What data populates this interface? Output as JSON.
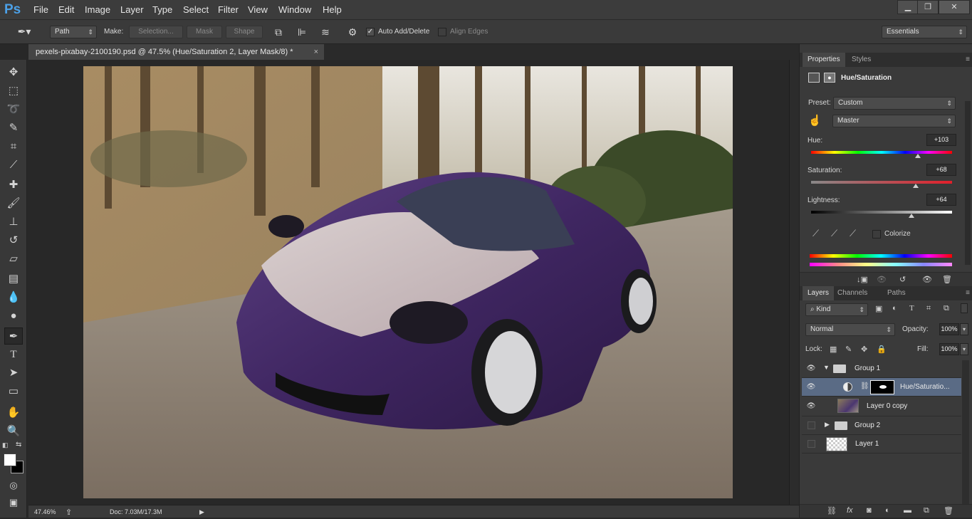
{
  "app": {
    "logo": "Ps"
  },
  "menu": [
    "File",
    "Edit",
    "Image",
    "Layer",
    "Type",
    "Select",
    "Filter",
    "View",
    "Window",
    "Help"
  ],
  "window_controls": {
    "minimize": "▁",
    "restore": "❐",
    "close": "✕"
  },
  "options": {
    "mode": "Path",
    "make_label": "Make:",
    "selection_btn": "Selection...",
    "mask_btn": "Mask",
    "shape_btn": "Shape",
    "auto_add_delete": "Auto Add/Delete",
    "align_edges": "Align Edges",
    "workspace": "Essentials"
  },
  "document": {
    "tab_title": "pexels-pixabay-2100190.psd @ 47.5% (Hue/Saturation 2, Layer Mask/8) *",
    "close": "×"
  },
  "status": {
    "zoom": "47.46%",
    "doc_info": "Doc: 7.03M/17.3M"
  },
  "properties": {
    "tabs": [
      "Properties",
      "Styles"
    ],
    "title": "Hue/Saturation",
    "preset_label": "Preset:",
    "preset_value": "Custom",
    "channel_value": "Master",
    "hue_label": "Hue:",
    "hue_value": "+103",
    "saturation_label": "Saturation:",
    "saturation_value": "+68",
    "lightness_label": "Lightness:",
    "lightness_value": "+64",
    "colorize_label": "Colorize",
    "hue_pos": 0.76,
    "saturation_pos": 0.74,
    "lightness_pos": 0.71
  },
  "layers_panel": {
    "tabs": [
      "Layers",
      "Channels",
      "Paths"
    ],
    "kind_label": "Kind",
    "blend_mode": "Normal",
    "opacity_label": "Opacity:",
    "opacity_value": "100%",
    "lock_label": "Lock:",
    "fill_label": "Fill:",
    "fill_value": "100%",
    "layers": [
      {
        "name": "Group 1"
      },
      {
        "name": "Hue/Saturatio..."
      },
      {
        "name": "Layer 0 copy"
      },
      {
        "name": "Group 2"
      },
      {
        "name": "Layer 1"
      }
    ]
  }
}
